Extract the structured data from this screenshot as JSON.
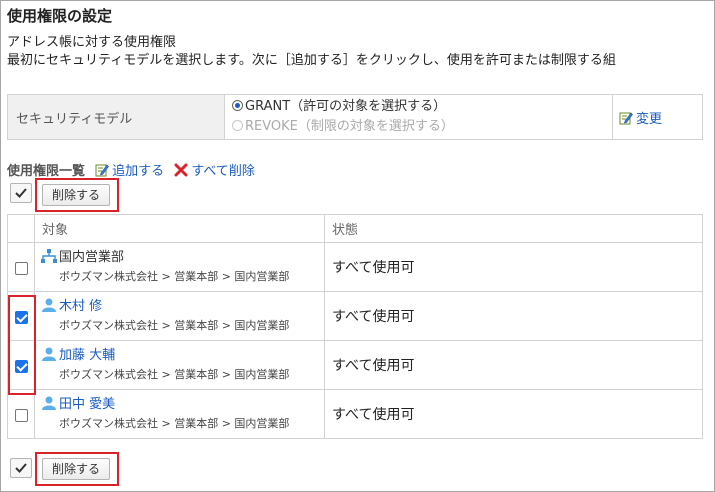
{
  "page": {
    "title": "使用権限の設定",
    "subtitle": "アドレス帳に対する使用権限",
    "instruction": "最初にセキュリティモデルを選択します。次に［追加する］をクリックし、使用を許可または制限する組"
  },
  "security_model": {
    "label": "セキュリティモデル",
    "grant_option": "GRANT（許可の対象を選択する）",
    "revoke_option": "REVOKE（制限の対象を選択する）",
    "selected": "GRANT",
    "change_link": "変更"
  },
  "permission_list": {
    "heading": "使用権限一覧",
    "add_link": "追加する",
    "delete_all_link": "すべて削除",
    "delete_button": "削除する",
    "columns": {
      "target": "対象",
      "status": "状態"
    },
    "rows": [
      {
        "type": "organization",
        "name": "国内営業部",
        "path": "ボウズマン株式会社 > 営業本部 > 国内営業部",
        "status": "すべて使用可",
        "checked": false,
        "is_link": false
      },
      {
        "type": "user",
        "name": "木村 修",
        "path": "ボウズマン株式会社 > 営業本部 > 国内営業部",
        "status": "すべて使用可",
        "checked": true,
        "is_link": true
      },
      {
        "type": "user",
        "name": "加藤 大輔",
        "path": "ボウズマン株式会社 > 営業本部 > 国内営業部",
        "status": "すべて使用可",
        "checked": true,
        "is_link": true
      },
      {
        "type": "user",
        "name": "田中 愛美",
        "path": "ボウズマン株式会社 > 営業本部 > 国内営業部",
        "status": "すべて使用可",
        "checked": false,
        "is_link": true
      }
    ]
  },
  "colors": {
    "link": "#1a5cc4",
    "highlight": "#d9232b",
    "checkbox_checked": "#1a73e8",
    "delete_x": "#d9232b"
  },
  "icons": {
    "edit": "pencil-notepad-icon",
    "delete": "red-x-icon",
    "organization": "org-tree-icon",
    "user": "user-icon",
    "check_all": "checkmark-icon"
  }
}
